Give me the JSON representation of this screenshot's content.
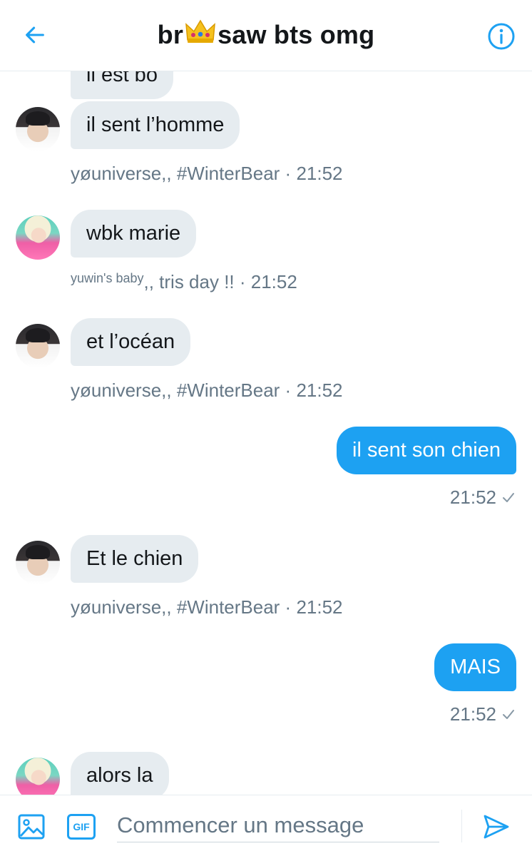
{
  "header": {
    "title_prefix": "br",
    "title_suffix": "saw bts omg",
    "back_icon": "arrow-left-icon",
    "info_icon": "info-icon",
    "crown_icon": "crown-emoji",
    "accent_color": "#1da1f2"
  },
  "messages": [
    {
      "side": "in",
      "text": "il est bo"
    },
    {
      "side": "in",
      "text": "il sent l’homme",
      "sender_name": "yøuniverse,, #WinterBear",
      "time": "21:52"
    },
    {
      "side": "in",
      "text": "wbk marie",
      "sender_small": "yuwin's baby",
      "sender_name": ",, tris day !!",
      "time": "21:52"
    },
    {
      "side": "in",
      "text": "et l’océan",
      "sender_name": "yøuniverse,, #WinterBear",
      "time": "21:52"
    },
    {
      "side": "out",
      "text": "il sent son chien",
      "time": "21:52"
    },
    {
      "side": "in",
      "text": "Et le chien",
      "sender_name": "yøuniverse,, #WinterBear",
      "time": "21:52"
    },
    {
      "side": "out",
      "text": "MAIS",
      "time": "21:52"
    },
    {
      "side": "in",
      "text": "alors la"
    }
  ],
  "meta_separator": " · ",
  "composer": {
    "placeholder": "Commencer un message",
    "gif_label": "GIF",
    "media_icon": "image-icon",
    "send_icon": "send-icon"
  }
}
